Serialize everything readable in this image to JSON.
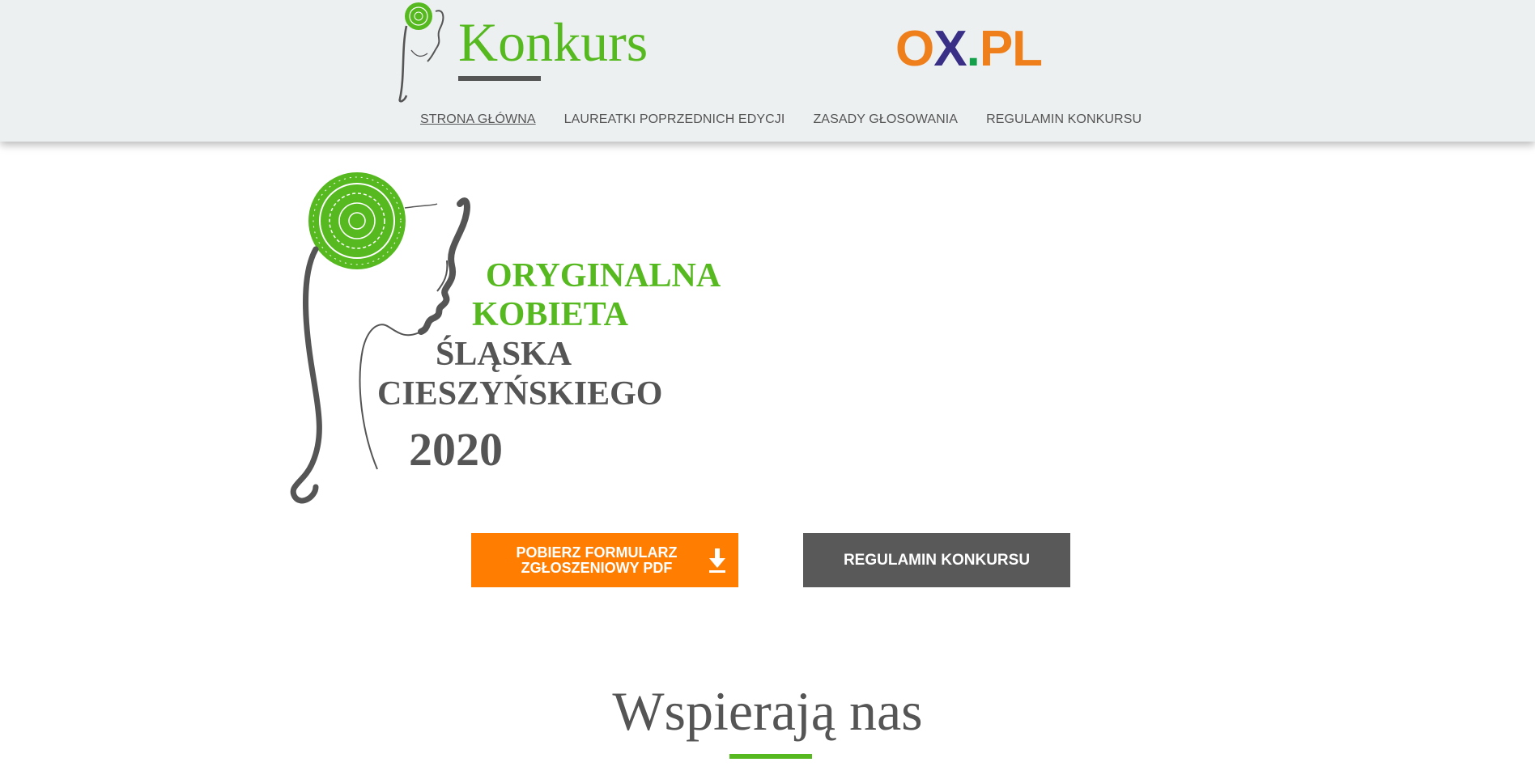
{
  "header": {
    "logo_text": "Konkurs",
    "partner_logo": {
      "o": "O",
      "x": "X",
      "dot": ".",
      "pl": "PL"
    },
    "nav": [
      {
        "label": "STRONA GŁÓWNA",
        "active": true
      },
      {
        "label": "LAUREATKI POPRZEDNICH EDYCJI",
        "active": false
      },
      {
        "label": "ZASADY GŁOSOWANIA",
        "active": false
      },
      {
        "label": "REGULAMIN KONKURSU",
        "active": false
      }
    ]
  },
  "hero": {
    "lines": [
      "ORYGINALNA",
      "KOBIETA",
      "ŚLĄSKA",
      "CIESZYŃSKIEGO",
      "2020"
    ]
  },
  "buttons": {
    "download_line1": "POBIERZ FORMULARZ",
    "download_line2": "ZGŁOSZENIOWY PDF",
    "rules_label": "REGULAMIN KONKURSU"
  },
  "section": {
    "title": "Wspierają nas"
  },
  "colors": {
    "green": "#56b920",
    "orange": "#ff7d00",
    "gray": "#555555",
    "button_gray": "#595959",
    "header_bg": "#edf0f1"
  }
}
